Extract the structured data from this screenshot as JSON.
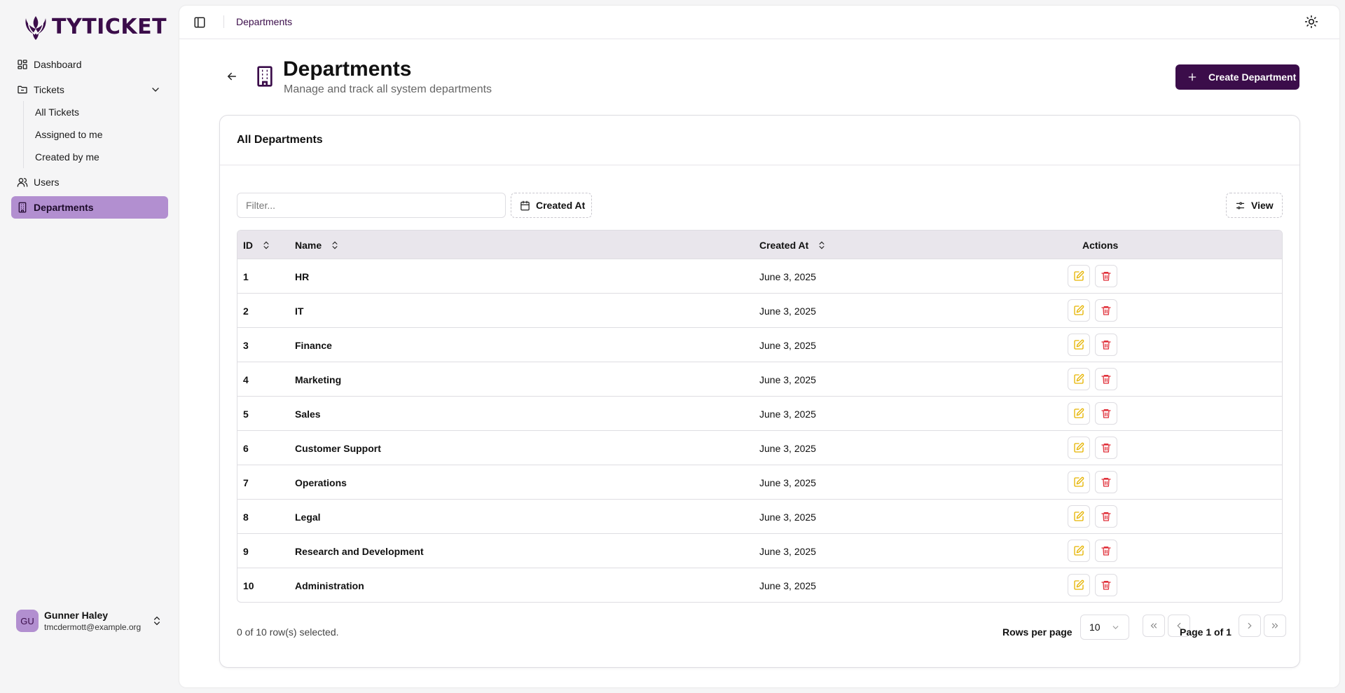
{
  "brand": {
    "name": "TYTICKET"
  },
  "sidebar": {
    "items": [
      {
        "label": "Dashboard",
        "icon": "dashboard-icon"
      },
      {
        "label": "Tickets",
        "icon": "folder-icon"
      },
      {
        "label": "Users",
        "icon": "users-icon"
      },
      {
        "label": "Departments",
        "icon": "building-icon"
      }
    ],
    "ticket_subitems": [
      "All Tickets",
      "Assigned to me",
      "Created by me"
    ],
    "user": {
      "initials": "GU",
      "name": "Gunner Haley",
      "email": "tmcdermott@example.org"
    }
  },
  "topbar": {
    "breadcrumb": "Departments"
  },
  "page": {
    "title": "Departments",
    "subtitle": "Manage and track all system departments",
    "create_label": "Create Department"
  },
  "card": {
    "title": "All Departments",
    "filter_placeholder": "Filter...",
    "created_at_filter": "Created At",
    "view_label": "View"
  },
  "table": {
    "columns": [
      "ID",
      "Name",
      "Created At",
      "Actions"
    ],
    "rows": [
      {
        "id": "1",
        "name": "HR",
        "created": "June 3, 2025"
      },
      {
        "id": "2",
        "name": "IT",
        "created": "June 3, 2025"
      },
      {
        "id": "3",
        "name": "Finance",
        "created": "June 3, 2025"
      },
      {
        "id": "4",
        "name": "Marketing",
        "created": "June 3, 2025"
      },
      {
        "id": "5",
        "name": "Sales",
        "created": "June 3, 2025"
      },
      {
        "id": "6",
        "name": "Customer Support",
        "created": "June 3, 2025"
      },
      {
        "id": "7",
        "name": "Operations",
        "created": "June 3, 2025"
      },
      {
        "id": "8",
        "name": "Legal",
        "created": "June 3, 2025"
      },
      {
        "id": "9",
        "name": "Research and Development",
        "created": "June 3, 2025"
      },
      {
        "id": "10",
        "name": "Administration",
        "created": "June 3, 2025"
      }
    ]
  },
  "footer": {
    "selected": "0 of 10 row(s) selected.",
    "rows_per_page_label": "Rows per page",
    "rows_per_page_value": "10",
    "page_info": "Page 1 of 1"
  },
  "colors": {
    "brand": "#3b0d4a",
    "active_nav": "#b28fd0",
    "edit": "#e6b400",
    "delete": "#e0303a"
  }
}
